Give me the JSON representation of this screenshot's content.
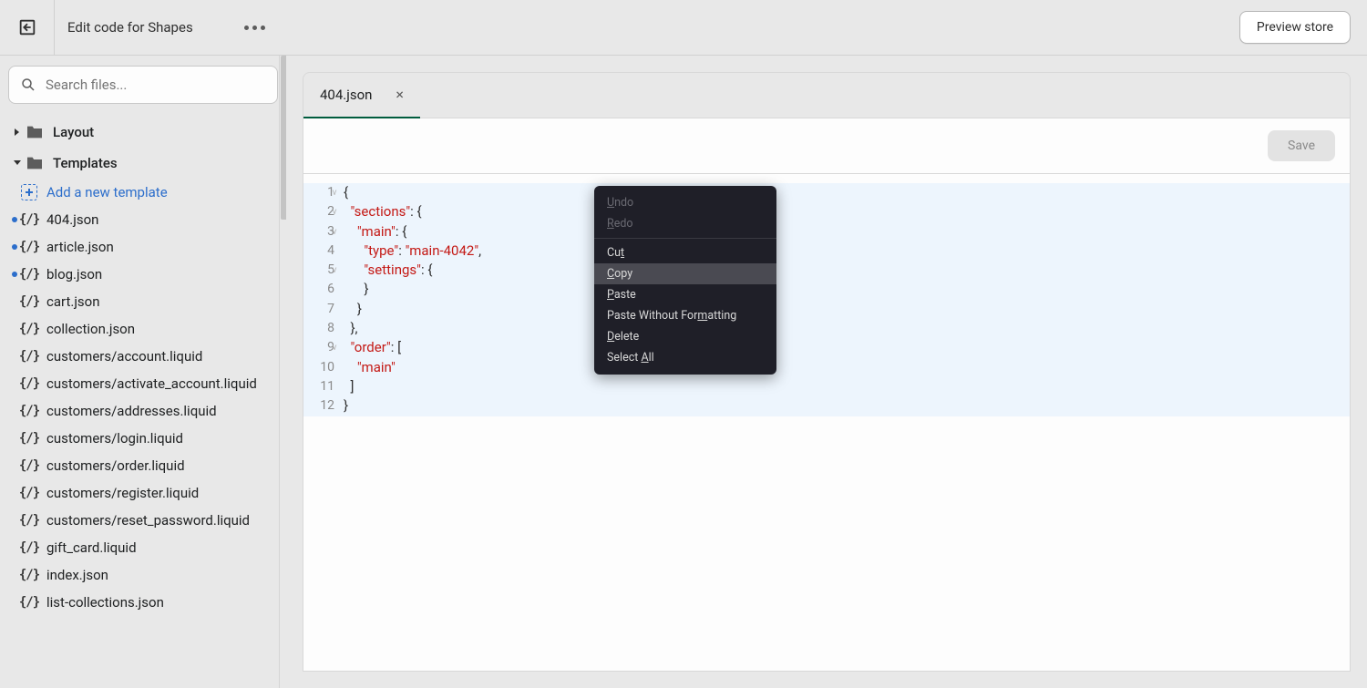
{
  "header": {
    "title": "Edit code for Shapes",
    "preview_label": "Preview store"
  },
  "search": {
    "placeholder": "Search files..."
  },
  "folders": {
    "layout": "Layout",
    "templates": "Templates"
  },
  "add_template": "Add a new template",
  "files": [
    {
      "name": "404.json",
      "modified": true
    },
    {
      "name": "article.json",
      "modified": true
    },
    {
      "name": "blog.json",
      "modified": true
    },
    {
      "name": "cart.json",
      "modified": false
    },
    {
      "name": "collection.json",
      "modified": false
    },
    {
      "name": "customers/account.liquid",
      "modified": false
    },
    {
      "name": "customers/activate_account.liquid",
      "modified": false
    },
    {
      "name": "customers/addresses.liquid",
      "modified": false
    },
    {
      "name": "customers/login.liquid",
      "modified": false
    },
    {
      "name": "customers/order.liquid",
      "modified": false
    },
    {
      "name": "customers/register.liquid",
      "modified": false
    },
    {
      "name": "customers/reset_password.liquid",
      "modified": false
    },
    {
      "name": "gift_card.liquid",
      "modified": false
    },
    {
      "name": "index.json",
      "modified": false
    },
    {
      "name": "list-collections.json",
      "modified": false
    }
  ],
  "tab": {
    "name": "404.json"
  },
  "save_label": "Save",
  "code": {
    "line_numbers": [
      "1",
      "2",
      "3",
      "4",
      "5",
      "6",
      "7",
      "8",
      "9",
      "10",
      "11",
      "12"
    ],
    "folds": [
      "v",
      "v",
      "v",
      "",
      "v",
      "",
      "",
      "",
      "v",
      "",
      "",
      ""
    ],
    "lines": [
      {
        "indent": "",
        "tokens": [
          {
            "t": "{",
            "c": ""
          }
        ]
      },
      {
        "indent": "  ",
        "tokens": [
          {
            "t": "\"sections\"",
            "c": "str"
          },
          {
            "t": ": {",
            "c": ""
          }
        ]
      },
      {
        "indent": "    ",
        "tokens": [
          {
            "t": "\"main\"",
            "c": "str"
          },
          {
            "t": ": {",
            "c": ""
          }
        ]
      },
      {
        "indent": "      ",
        "tokens": [
          {
            "t": "\"type\"",
            "c": "str"
          },
          {
            "t": ": ",
            "c": ""
          },
          {
            "t": "\"main-4042\"",
            "c": "str"
          },
          {
            "t": ",",
            "c": ""
          }
        ]
      },
      {
        "indent": "      ",
        "tokens": [
          {
            "t": "\"settings\"",
            "c": "str"
          },
          {
            "t": ": {",
            "c": ""
          }
        ]
      },
      {
        "indent": "      ",
        "tokens": [
          {
            "t": "}",
            "c": ""
          }
        ]
      },
      {
        "indent": "    ",
        "tokens": [
          {
            "t": "}",
            "c": ""
          }
        ]
      },
      {
        "indent": "  ",
        "tokens": [
          {
            "t": "},",
            "c": ""
          }
        ]
      },
      {
        "indent": "  ",
        "tokens": [
          {
            "t": "\"order\"",
            "c": "str"
          },
          {
            "t": ": [",
            "c": ""
          }
        ]
      },
      {
        "indent": "    ",
        "tokens": [
          {
            "t": "\"main\"",
            "c": "str"
          }
        ]
      },
      {
        "indent": "  ",
        "tokens": [
          {
            "t": "]",
            "c": ""
          }
        ]
      },
      {
        "indent": "",
        "tokens": [
          {
            "t": "}",
            "c": ""
          }
        ]
      }
    ]
  },
  "context_menu": {
    "undo": "Undo",
    "undo_u": "U",
    "redo": "Redo",
    "redo_u": "R",
    "cut": "Cut",
    "cut_u": "t",
    "copy": "Copy",
    "copy_u": "C",
    "paste": "Paste",
    "paste_u": "P",
    "pwf": "Paste Without Formatting",
    "pwf_pre": "Paste Without For",
    "pwf_u": "m",
    "pwf_post": "atting",
    "delete": "Delete",
    "delete_u": "D",
    "select_all_pre": "Select ",
    "select_all_u": "A",
    "select_all_post": "ll"
  }
}
